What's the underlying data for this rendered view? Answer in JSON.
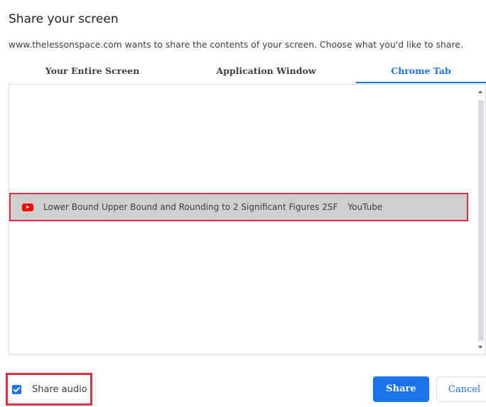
{
  "dialog": {
    "title": "Share your screen",
    "description": "www.thelessonspace.com wants to share the contents of your screen. Choose what you'd like to share."
  },
  "tabs": [
    {
      "label": "Your Entire Screen",
      "active": false
    },
    {
      "label": "Application Window",
      "active": false
    },
    {
      "label": "Chrome Tab",
      "active": true
    }
  ],
  "tab_list": [
    {
      "icon": "youtube-icon",
      "title": "Lower Bound Upper Bound and Rounding to 2 Significant Figures 2SF",
      "source": "YouTube",
      "selected": true
    }
  ],
  "audio": {
    "label": "Share audio",
    "checked": true
  },
  "buttons": {
    "share_label": "Share",
    "cancel_label": "Cancel"
  },
  "colors": {
    "accent": "#1a73e8",
    "highlight_outline": "#d93042",
    "selected_row": "#cfcfcf"
  }
}
